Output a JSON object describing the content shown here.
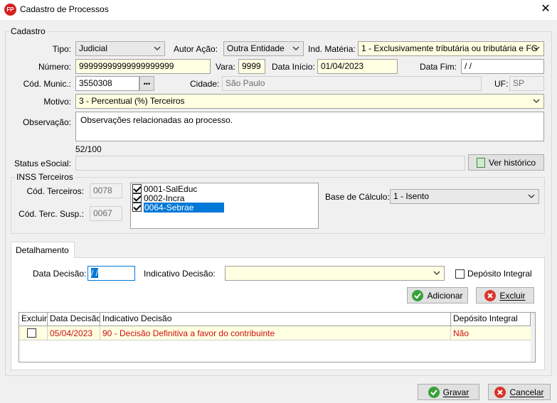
{
  "window": {
    "title": "Cadastro de Processos",
    "app_icon_text": "FP",
    "close_glyph": "✕"
  },
  "cadastro": {
    "group_label": "Cadastro",
    "tipo_label": "Tipo:",
    "tipo_value": "Judicial",
    "autor_label": "Autor Ação:",
    "autor_value": "Outra Entidade",
    "materia_label": "Ind. Matéria:",
    "materia_value": "1 - Exclusivamente tributária ou tributária e FG",
    "numero_label": "Número:",
    "numero_value": "99999999999999999999",
    "vara_label": "Vara:",
    "vara_value": "9999",
    "data_inicio_label": "Data Início:",
    "data_inicio_value": "01/04/2023",
    "data_fim_label": "Data Fim:",
    "data_fim_value": " / /",
    "cod_munic_label": "Cód. Munic.:",
    "cod_munic_value": "3550308",
    "cod_munic_btn": "•••",
    "cidade_label": "Cidade:",
    "cidade_value": "São Paulo",
    "uf_label": "UF:",
    "uf_value": "SP",
    "motivo_label": "Motivo:",
    "motivo_value": "3 - Percentual (%) Terceiros",
    "observacao_label": "Observação:",
    "observacao_value": "Observações relacionadas ao processo.",
    "char_count": "52/100",
    "status_label": "Status eSocial:",
    "status_value": "",
    "historico_button": "Ver histórico"
  },
  "inss": {
    "group_label": "INSS Terceiros",
    "cod_terceiros_label": "Cód. Terceiros:",
    "cod_terceiros_value": "0078",
    "cod_susp_label": "Cód. Terc. Susp.:",
    "cod_susp_value": "0067",
    "items": [
      {
        "label": "0001-SalEduc",
        "checked": true
      },
      {
        "label": "0002-Incra",
        "checked": true
      },
      {
        "label": "0064-Sebrae",
        "checked": true
      }
    ],
    "base_label": "Base de Cálculo:",
    "base_value": "1 - Isento"
  },
  "detalhamento": {
    "tab_label": "Detalhamento",
    "data_decisao_label": "Data Decisão:",
    "data_decisao_value": " / /",
    "indicativo_label": "Indicativo Decisão:",
    "indicativo_value": "",
    "deposito_label": "Depósito Integral",
    "adicionar_button": "Adicionar",
    "excluir_button": "Excluir",
    "grid": {
      "headers": [
        "Excluir",
        "Data Decisão",
        "Indicativo Decisão",
        "Depósito Integral"
      ],
      "rows": [
        {
          "excluir": false,
          "data": "05/04/2023",
          "indicativo": "90 - Decisão Definitiva a favor do contribuinte",
          "deposito": "Não"
        }
      ]
    }
  },
  "footer": {
    "gravar_button": "Gravar",
    "cancelar_button": "Cancelar"
  },
  "colors": {
    "accent_green": "#3aa03a",
    "accent_red": "#d9342b",
    "row_text": "#cc1010",
    "field_yellow": "#ffffe1"
  }
}
